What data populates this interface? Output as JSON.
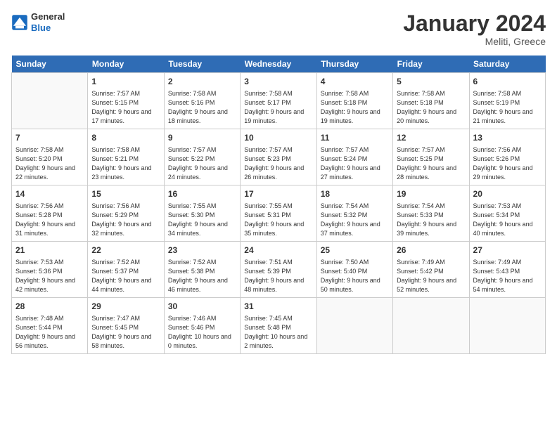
{
  "logo": {
    "line1": "General",
    "line2": "Blue"
  },
  "title": "January 2024",
  "location": "Meliti, Greece",
  "days_of_week": [
    "Sunday",
    "Monday",
    "Tuesday",
    "Wednesday",
    "Thursday",
    "Friday",
    "Saturday"
  ],
  "weeks": [
    [
      {
        "day": "",
        "info": ""
      },
      {
        "day": "1",
        "info": "Sunrise: 7:57 AM\nSunset: 5:15 PM\nDaylight: 9 hours\nand 17 minutes."
      },
      {
        "day": "2",
        "info": "Sunrise: 7:58 AM\nSunset: 5:16 PM\nDaylight: 9 hours\nand 18 minutes."
      },
      {
        "day": "3",
        "info": "Sunrise: 7:58 AM\nSunset: 5:17 PM\nDaylight: 9 hours\nand 19 minutes."
      },
      {
        "day": "4",
        "info": "Sunrise: 7:58 AM\nSunset: 5:18 PM\nDaylight: 9 hours\nand 19 minutes."
      },
      {
        "day": "5",
        "info": "Sunrise: 7:58 AM\nSunset: 5:18 PM\nDaylight: 9 hours\nand 20 minutes."
      },
      {
        "day": "6",
        "info": "Sunrise: 7:58 AM\nSunset: 5:19 PM\nDaylight: 9 hours\nand 21 minutes."
      }
    ],
    [
      {
        "day": "7",
        "info": "Sunrise: 7:58 AM\nSunset: 5:20 PM\nDaylight: 9 hours\nand 22 minutes."
      },
      {
        "day": "8",
        "info": "Sunrise: 7:58 AM\nSunset: 5:21 PM\nDaylight: 9 hours\nand 23 minutes."
      },
      {
        "day": "9",
        "info": "Sunrise: 7:57 AM\nSunset: 5:22 PM\nDaylight: 9 hours\nand 24 minutes."
      },
      {
        "day": "10",
        "info": "Sunrise: 7:57 AM\nSunset: 5:23 PM\nDaylight: 9 hours\nand 26 minutes."
      },
      {
        "day": "11",
        "info": "Sunrise: 7:57 AM\nSunset: 5:24 PM\nDaylight: 9 hours\nand 27 minutes."
      },
      {
        "day": "12",
        "info": "Sunrise: 7:57 AM\nSunset: 5:25 PM\nDaylight: 9 hours\nand 28 minutes."
      },
      {
        "day": "13",
        "info": "Sunrise: 7:56 AM\nSunset: 5:26 PM\nDaylight: 9 hours\nand 29 minutes."
      }
    ],
    [
      {
        "day": "14",
        "info": "Sunrise: 7:56 AM\nSunset: 5:28 PM\nDaylight: 9 hours\nand 31 minutes."
      },
      {
        "day": "15",
        "info": "Sunrise: 7:56 AM\nSunset: 5:29 PM\nDaylight: 9 hours\nand 32 minutes."
      },
      {
        "day": "16",
        "info": "Sunrise: 7:55 AM\nSunset: 5:30 PM\nDaylight: 9 hours\nand 34 minutes."
      },
      {
        "day": "17",
        "info": "Sunrise: 7:55 AM\nSunset: 5:31 PM\nDaylight: 9 hours\nand 35 minutes."
      },
      {
        "day": "18",
        "info": "Sunrise: 7:54 AM\nSunset: 5:32 PM\nDaylight: 9 hours\nand 37 minutes."
      },
      {
        "day": "19",
        "info": "Sunrise: 7:54 AM\nSunset: 5:33 PM\nDaylight: 9 hours\nand 39 minutes."
      },
      {
        "day": "20",
        "info": "Sunrise: 7:53 AM\nSunset: 5:34 PM\nDaylight: 9 hours\nand 40 minutes."
      }
    ],
    [
      {
        "day": "21",
        "info": "Sunrise: 7:53 AM\nSunset: 5:36 PM\nDaylight: 9 hours\nand 42 minutes."
      },
      {
        "day": "22",
        "info": "Sunrise: 7:52 AM\nSunset: 5:37 PM\nDaylight: 9 hours\nand 44 minutes."
      },
      {
        "day": "23",
        "info": "Sunrise: 7:52 AM\nSunset: 5:38 PM\nDaylight: 9 hours\nand 46 minutes."
      },
      {
        "day": "24",
        "info": "Sunrise: 7:51 AM\nSunset: 5:39 PM\nDaylight: 9 hours\nand 48 minutes."
      },
      {
        "day": "25",
        "info": "Sunrise: 7:50 AM\nSunset: 5:40 PM\nDaylight: 9 hours\nand 50 minutes."
      },
      {
        "day": "26",
        "info": "Sunrise: 7:49 AM\nSunset: 5:42 PM\nDaylight: 9 hours\nand 52 minutes."
      },
      {
        "day": "27",
        "info": "Sunrise: 7:49 AM\nSunset: 5:43 PM\nDaylight: 9 hours\nand 54 minutes."
      }
    ],
    [
      {
        "day": "28",
        "info": "Sunrise: 7:48 AM\nSunset: 5:44 PM\nDaylight: 9 hours\nand 56 minutes."
      },
      {
        "day": "29",
        "info": "Sunrise: 7:47 AM\nSunset: 5:45 PM\nDaylight: 9 hours\nand 58 minutes."
      },
      {
        "day": "30",
        "info": "Sunrise: 7:46 AM\nSunset: 5:46 PM\nDaylight: 10 hours\nand 0 minutes."
      },
      {
        "day": "31",
        "info": "Sunrise: 7:45 AM\nSunset: 5:48 PM\nDaylight: 10 hours\nand 2 minutes."
      },
      {
        "day": "",
        "info": ""
      },
      {
        "day": "",
        "info": ""
      },
      {
        "day": "",
        "info": ""
      }
    ]
  ]
}
